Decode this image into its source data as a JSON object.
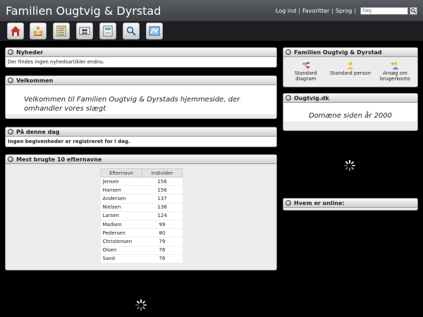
{
  "header": {
    "title": "Familien Ougtvig & Dyrstad",
    "links": [
      "Log ind",
      "Favoritter",
      "Sprog"
    ],
    "search_placeholder": "Søg"
  },
  "toolbar": [
    "home-icon",
    "family-icon",
    "list-icon",
    "people-card-icon",
    "document-icon",
    "search-icon",
    "map-icon"
  ],
  "news": {
    "title": "Nyheder",
    "text": "Der findes ingen nyhedsartikler endnu."
  },
  "welcome": {
    "title": "Velkommen",
    "text": "Velkommen til Familien Ougtvig & Dyrstads hjemmeside, der omhandler vores slægt"
  },
  "today": {
    "title": "På denne dag",
    "text": "Ingen begivenheder er registreret for i dag."
  },
  "surnames": {
    "title": "Mest brugte 10 efternavne",
    "headers": [
      "Efternavn",
      "Individer"
    ],
    "rows": [
      [
        "Jensen",
        "156"
      ],
      [
        "Hansen",
        "156"
      ],
      [
        "Andersen",
        "137"
      ],
      [
        "Nielsen",
        "136"
      ],
      [
        "Larsen",
        "124"
      ],
      [
        "Madsen",
        "99"
      ],
      [
        "Pedersen",
        "80"
      ],
      [
        "Christensen",
        "79"
      ],
      [
        "Olsen",
        "76"
      ],
      [
        "Sand",
        "76"
      ]
    ]
  },
  "family_box": {
    "title": "Familien Ougtvig & Dyrstad",
    "items": [
      "Standard diagram",
      "Standard person",
      "Ansøg om brugerkonto"
    ]
  },
  "ougtvig": {
    "title": "Ougtvig.dk",
    "text": "Domæne siden år 2000"
  },
  "online": {
    "title": "Hvem er online:"
  },
  "colors": {
    "header_bg": "#4a4c52",
    "page_bg": "#000000",
    "box_bg": "#ececec"
  }
}
